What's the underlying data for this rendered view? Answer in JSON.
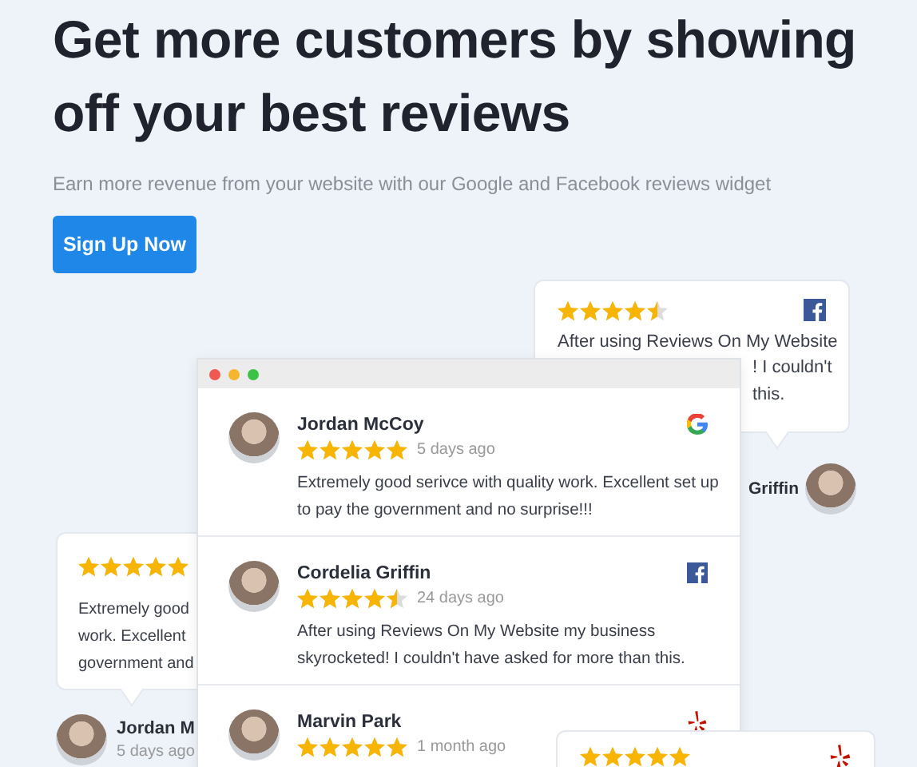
{
  "headline": "Get more customers by showing off your best reviews",
  "subheadline": "Earn more revenue from your website with our Google and Facebook reviews widget",
  "cta": {
    "label": "Sign Up Now"
  },
  "widget_window": {
    "reviews": [
      {
        "name": "Jordan McCoy",
        "stars": 5,
        "time": "5 days ago",
        "text": "Extremely good serivce with quality work. Excellent set up to pay the government and no surprise!!!",
        "kind": "google"
      },
      {
        "name": "Cordelia Griffin",
        "stars": 4.5,
        "time": "24 days ago",
        "text": "After using Reviews On My Website my business skyrocketed! I couldn't have asked for more than this.",
        "kind": "facebook"
      },
      {
        "name": "Marvin Park",
        "stars": 5,
        "time": "1 month ago",
        "kind": "yelp"
      }
    ]
  },
  "back_cards": [
    {
      "stars": 4.5,
      "kind": "facebook",
      "lines": [
        "After using Reviews On My Website",
        "! I couldn't",
        "this."
      ],
      "reviewer": {
        "name": "Griffin"
      }
    },
    {
      "stars": 5,
      "lines": [
        "Extremely good",
        "work. Excellent",
        "government and"
      ],
      "reviewer": {
        "name": "Jordan M",
        "time": "5 days ago"
      }
    },
    {
      "stars": 5,
      "kind": "yelp"
    }
  ]
}
